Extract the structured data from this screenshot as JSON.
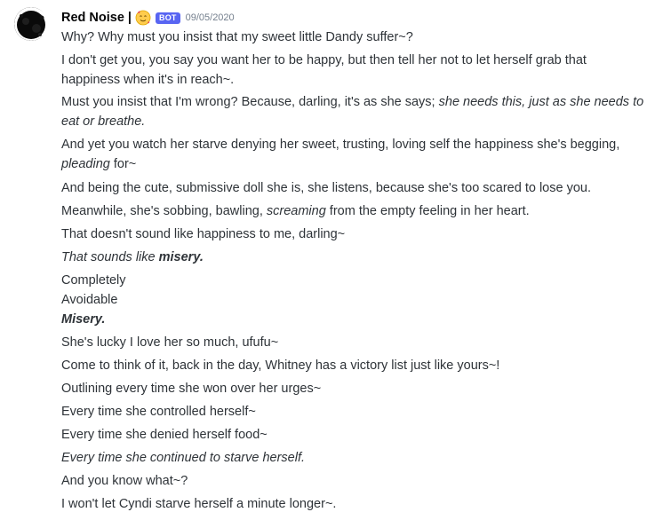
{
  "author": {
    "name": "Red Noise |",
    "emoji_icon": "face-with-hearts-emoji",
    "bot_tag": "BOT",
    "timestamp": "09/05/2020"
  },
  "messages": [
    {
      "parts": [
        "Why? Why must you insist that my sweet little Dandy suffer~?"
      ]
    },
    {
      "parts": [
        "I don't get you, you say you want her to be happy, but then tell her not to let herself grab that happiness when it's in reach~."
      ]
    },
    {
      "a": "Must you insist that I'm wrong? Because, darling, it's as she says; ",
      "b": "she needs this, just as she needs to eat or breathe."
    },
    {
      "a": "And yet you watch her starve denying her sweet, trusting, loving self the happiness she's begging, ",
      "b": "pleading",
      "c": " for~"
    },
    {
      "parts": [
        "And being the cute, submissive doll she is, she listens, because she's too scared to lose you."
      ]
    },
    {
      "a": "Meanwhile, she's sobbing, bawling, ",
      "b": "screaming",
      "c": " from the empty feeling in her heart."
    },
    {
      "parts": [
        "That doesn't sound like happiness to me, darling~"
      ]
    },
    {
      "a": "That sounds like ",
      "b": "misery."
    },
    {
      "parts": [
        "Completely"
      ]
    },
    {
      "parts": [
        "Avoidable"
      ]
    },
    {
      "parts": [
        "Misery."
      ]
    },
    {
      "parts": [
        "She's lucky I love her so much, ufufu~"
      ]
    },
    {
      "parts": [
        "Come to think of it, back in the day, Whitney has a victory list just like yours~!"
      ]
    },
    {
      "parts": [
        "Outlining every time she won over her urges~"
      ]
    },
    {
      "parts": [
        "Every time she controlled herself~"
      ]
    },
    {
      "parts": [
        "Every time she denied herself food~"
      ]
    },
    {
      "parts": [
        "Every time she continued to starve herself."
      ]
    },
    {
      "parts": [
        "And you know what~?"
      ]
    },
    {
      "parts": [
        "I won't let Cyndi starve herself a minute longer~."
      ]
    }
  ],
  "colors": {
    "bot_tag": "#5865f2",
    "timestamp": "#747f8d",
    "text": "#2e3338"
  }
}
